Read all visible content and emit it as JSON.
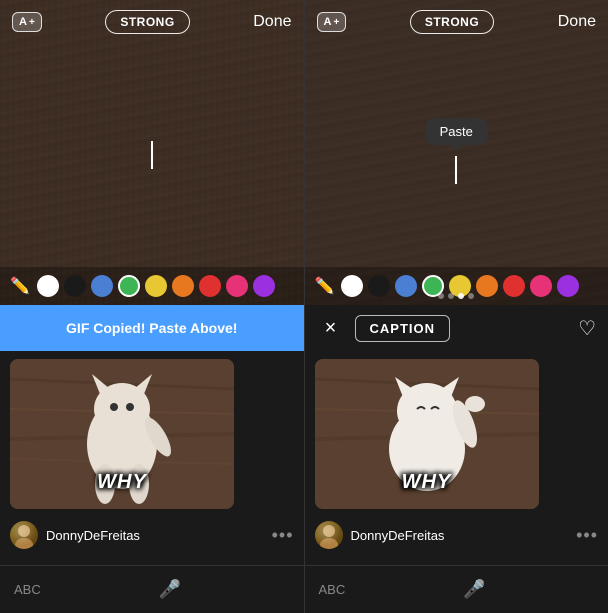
{
  "left_panel": {
    "toolbar": {
      "font_size_label": "A",
      "font_size_plus": "+",
      "style_label": "STRONG",
      "done_label": "Done"
    },
    "notification": {
      "text": "GIF Copied! Paste Above!"
    },
    "gif_item": {
      "why_text": "WHY",
      "username": "DonnyDeFreitas"
    },
    "bottom_bar": {
      "abc_label": "ABC"
    },
    "colors": [
      {
        "name": "white",
        "hex": "#ffffff",
        "active": false
      },
      {
        "name": "black",
        "hex": "#1a1a1a",
        "active": false
      },
      {
        "name": "blue",
        "hex": "#4a7fd4",
        "active": false
      },
      {
        "name": "green",
        "hex": "#3db554",
        "active": false
      },
      {
        "name": "yellow",
        "hex": "#e8c832",
        "active": false
      },
      {
        "name": "orange",
        "hex": "#e87820",
        "active": false
      },
      {
        "name": "red",
        "hex": "#e03030",
        "active": false
      },
      {
        "name": "pink",
        "hex": "#e83278",
        "active": false
      },
      {
        "name": "purple",
        "hex": "#9b30e0",
        "active": false
      }
    ]
  },
  "right_panel": {
    "toolbar": {
      "font_size_label": "A",
      "font_size_plus": "+",
      "style_label": "STRONG",
      "done_label": "Done"
    },
    "paste_tooltip": "Paste",
    "caption_bar": {
      "close_label": "×",
      "caption_label": "CAPTION"
    },
    "gif_item": {
      "why_text": "WHY",
      "username": "DonnyDeFreitas"
    },
    "bottom_bar": {
      "abc_label": "ABC"
    },
    "colors": [
      {
        "name": "white",
        "hex": "#ffffff",
        "active": false
      },
      {
        "name": "black",
        "hex": "#1a1a1a",
        "active": false
      },
      {
        "name": "blue",
        "hex": "#4a7fd4",
        "active": false
      },
      {
        "name": "green",
        "hex": "#3db554",
        "active": false
      },
      {
        "name": "yellow",
        "hex": "#e8c832",
        "active": false
      },
      {
        "name": "orange",
        "hex": "#e87820",
        "active": false
      },
      {
        "name": "red",
        "hex": "#e03030",
        "active": false
      },
      {
        "name": "pink",
        "hex": "#e83278",
        "active": false
      },
      {
        "name": "purple",
        "hex": "#9b30e0",
        "active": false
      }
    ],
    "dots": [
      false,
      false,
      true,
      false
    ]
  }
}
